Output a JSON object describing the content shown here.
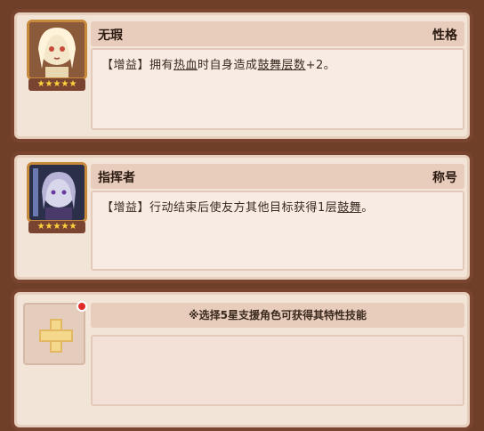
{
  "traits": [
    {
      "name": "无瑕",
      "tag": "性格",
      "stars": "★★★★★",
      "desc_parts": [
        "【增益】拥有",
        "热血",
        "时自身造成",
        "鼓舞层数",
        "+2。"
      ]
    },
    {
      "name": "指挥者",
      "tag": "称号",
      "stars": "★★★★★",
      "desc_parts": [
        "【增益】行动结束后使友方其他目标获得1层",
        "鼓舞",
        "。"
      ]
    }
  ],
  "support_slot": {
    "hint": "※选择5星支援角色可获得其特性技能"
  },
  "colors": {
    "background": "#6f3f28",
    "card": "#f3e4d8",
    "header": "#e8ccbc",
    "star": "#ffd23f",
    "notification": "#e02a2a"
  },
  "icons": [
    "plus-icon",
    "star-icon",
    "notification-dot-icon"
  ]
}
